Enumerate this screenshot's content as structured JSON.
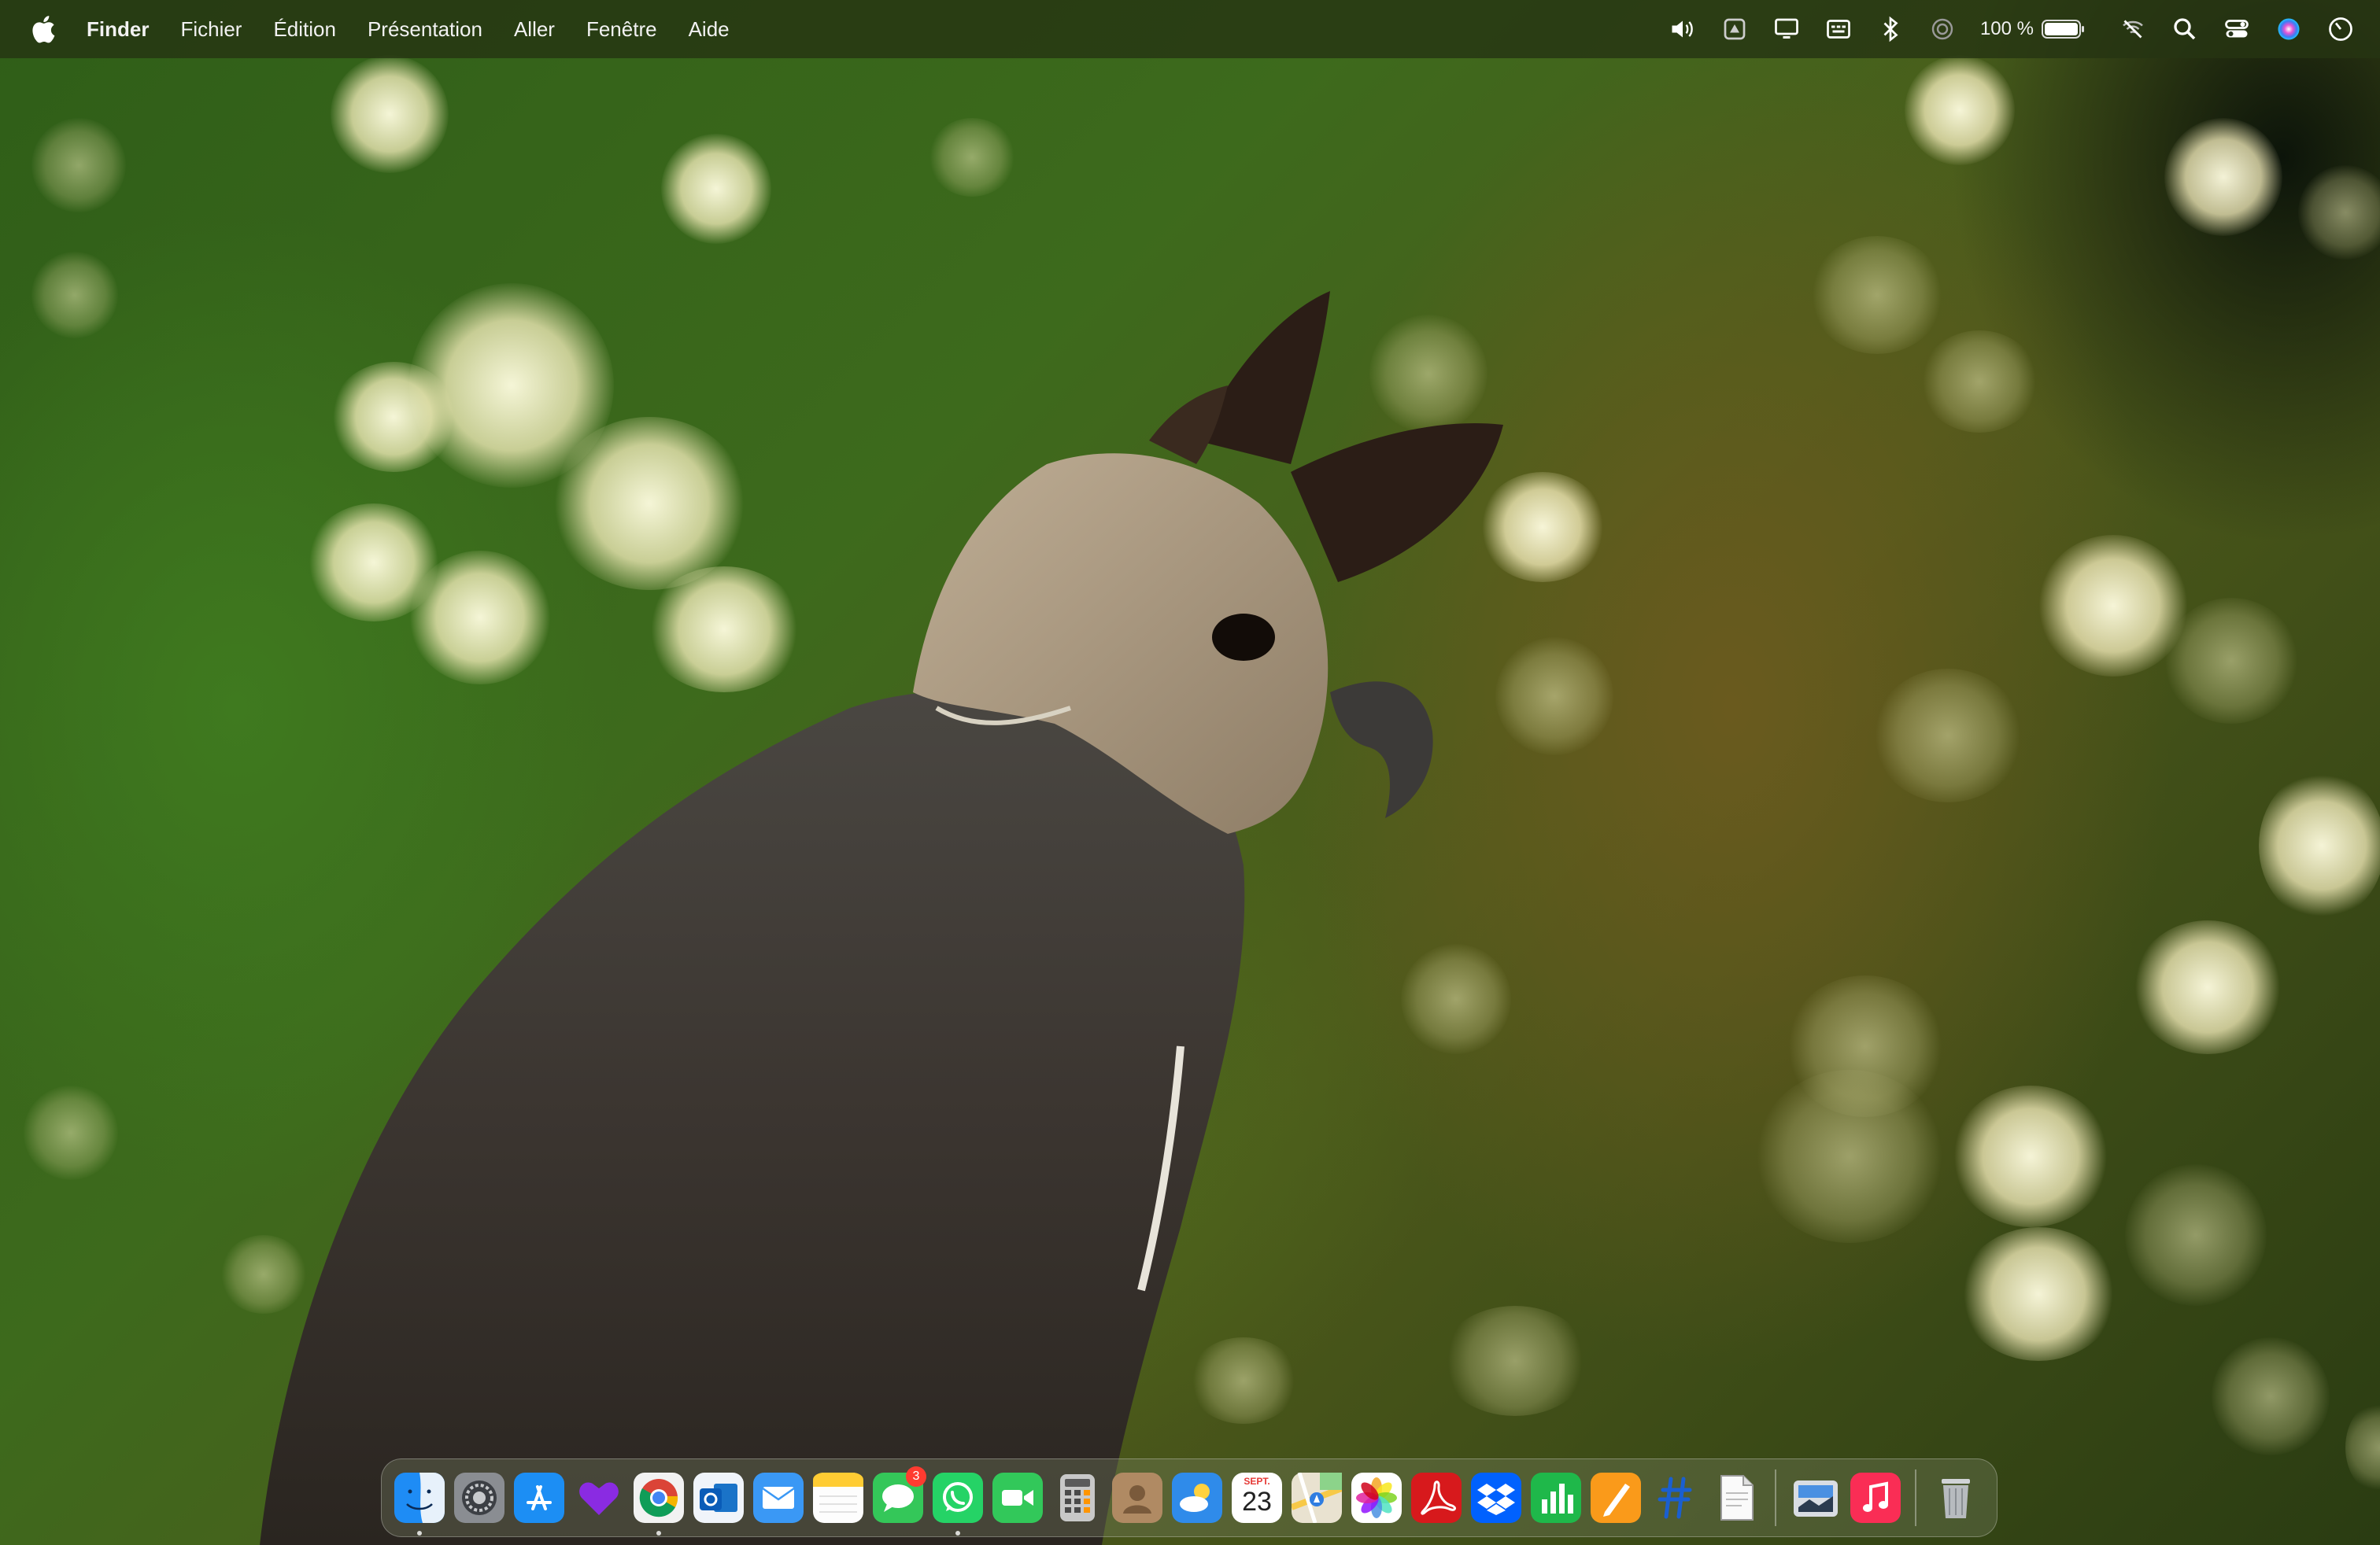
{
  "menubar": {
    "apple_icon": "apple-logo-icon",
    "app_name": "Finder",
    "menus": [
      "Fichier",
      "Édition",
      "Présentation",
      "Aller",
      "Fenêtre",
      "Aide"
    ],
    "status_icons": [
      "volume-icon",
      "drive-icon",
      "display-icon",
      "keyboard-input-icon",
      "bluetooth-icon",
      "airdrop-icon"
    ],
    "battery_percent": "100 %",
    "battery_level": 1.0,
    "right_icons": [
      "wifi-off-icon",
      "search-icon",
      "control-center-icon",
      "siri-icon",
      "clock-icon"
    ]
  },
  "dock": {
    "apps": [
      {
        "name": "Finder",
        "icon": "finder-icon",
        "running": true
      },
      {
        "name": "Réglages Système",
        "icon": "system-settings-icon",
        "running": false
      },
      {
        "name": "App Store",
        "icon": "app-store-icon",
        "running": false
      },
      {
        "name": "Obsidian",
        "icon": "purple-heart-icon",
        "running": false
      },
      {
        "name": "Google Chrome",
        "icon": "chrome-icon",
        "running": true
      },
      {
        "name": "Outlook",
        "icon": "outlook-icon",
        "running": false
      },
      {
        "name": "Mail",
        "icon": "mail-icon",
        "running": false
      },
      {
        "name": "Notes",
        "icon": "notes-icon",
        "running": false
      },
      {
        "name": "Messages",
        "icon": "messages-icon",
        "running": false,
        "badge": "3"
      },
      {
        "name": "WhatsApp",
        "icon": "whatsapp-icon",
        "running": true
      },
      {
        "name": "FaceTime",
        "icon": "facetime-icon",
        "running": false
      },
      {
        "name": "Calculette",
        "icon": "calculator-icon",
        "running": false
      },
      {
        "name": "Contacts",
        "icon": "contacts-icon",
        "running": false
      },
      {
        "name": "Météo",
        "icon": "weather-icon",
        "running": false
      },
      {
        "name": "Calendrier",
        "icon": "calendar-icon",
        "running": false,
        "month": "SEPT.",
        "day": "23"
      },
      {
        "name": "Plans",
        "icon": "maps-icon",
        "running": false
      },
      {
        "name": "Photos",
        "icon": "photos-icon",
        "running": false
      },
      {
        "name": "Acrobat",
        "icon": "acrobat-icon",
        "running": false
      },
      {
        "name": "Dropbox",
        "icon": "dropbox-icon",
        "running": false
      },
      {
        "name": "Numbers",
        "icon": "numbers-icon",
        "running": false
      },
      {
        "name": "Pages",
        "icon": "pages-icon",
        "running": false
      },
      {
        "name": "Xcode",
        "icon": "xcode-icon",
        "running": false
      },
      {
        "name": "TextEdit",
        "icon": "textedit-icon",
        "running": false
      }
    ],
    "extras": [
      {
        "name": "Aperçu",
        "icon": "preview-icon"
      },
      {
        "name": "Musique",
        "icon": "music-icon"
      }
    ],
    "trash": {
      "name": "Corbeille",
      "icon": "trash-icon"
    }
  },
  "colors": {
    "menubar_bg": "#26341 2",
    "dock_bg": "#788264"
  }
}
